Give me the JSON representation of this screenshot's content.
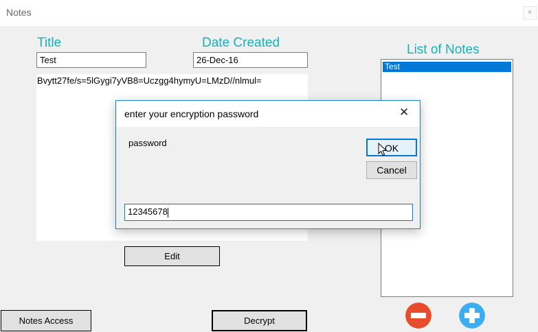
{
  "window": {
    "title": "Notes",
    "close_glyph": "×"
  },
  "form": {
    "title_label": "Title",
    "title_value": "Test",
    "date_label": "Date Created",
    "date_value": "26-Dec-16",
    "note_body": "Bvytt27fe/s=5lGygi7yVB8=Uczgg4hymyU=LMzD//nlmul=",
    "edit_label": "Edit"
  },
  "notes_list": {
    "label": "List of Notes",
    "items": [
      "Test"
    ],
    "remove_icon": "minus-circle-icon",
    "add_icon": "plus-circle-icon"
  },
  "bottom": {
    "notes_access_label": "Notes Access",
    "decrypt_label": "Decrypt"
  },
  "dialog": {
    "title": "enter your encryption password",
    "close_glyph": "✕",
    "prompt": "password",
    "ok_label": "OK",
    "cancel_label": "Cancel",
    "input_value": "12345678"
  },
  "colors": {
    "accent_teal": "#1ab0b8",
    "selection_blue": "#0078d7",
    "remove_red": "#e74c2c",
    "add_blue": "#3aaef0"
  }
}
